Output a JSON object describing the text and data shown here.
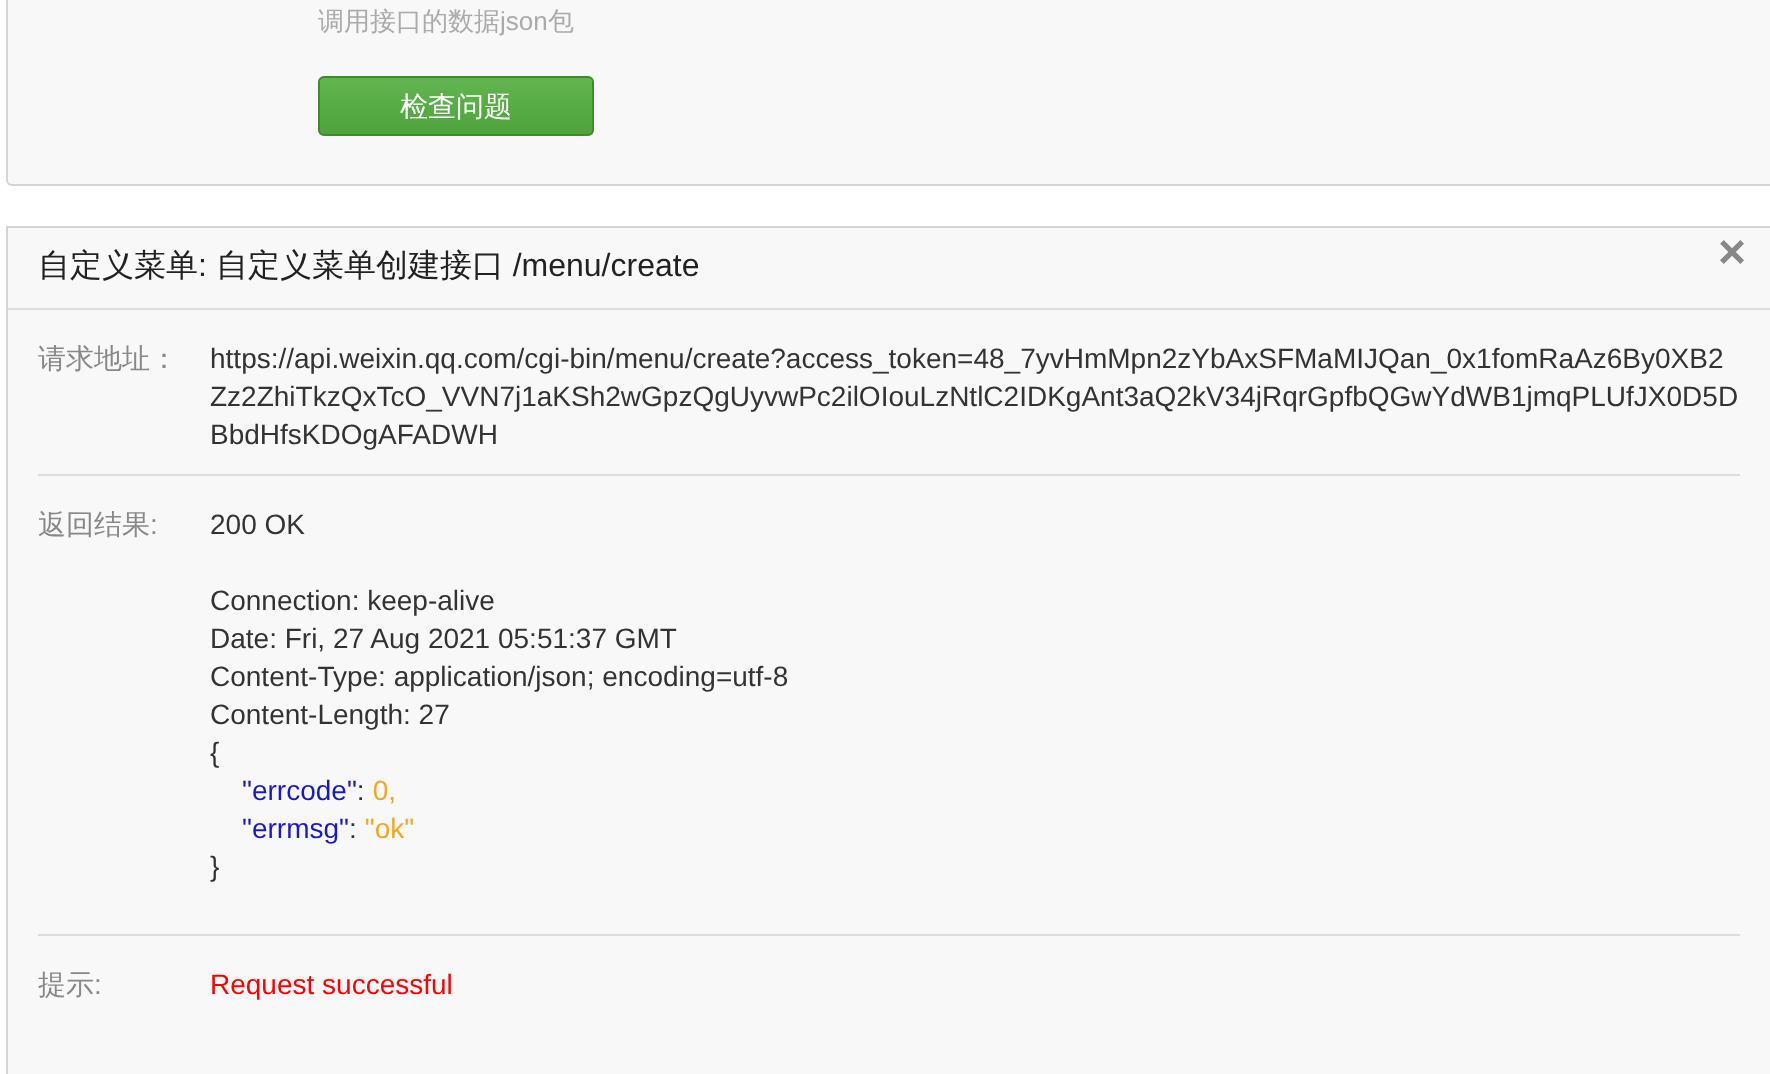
{
  "top_panel": {
    "hint": "调用接口的数据json包",
    "button": "检查问题"
  },
  "result_panel": {
    "title": "自定义菜单: 自定义菜单创建接口 /menu/create",
    "close": "×",
    "request": {
      "label": "请求地址：",
      "url": "https://api.weixin.qq.com/cgi-bin/menu/create?access_token=48_7yvHmMpn2zYbAxSFMaMIJQan_0x1fomRaAz6By0XB2Zz2ZhiTkzQxTcO_VVN7j1aKSh2wGpzQgUyvwPc2ilOIouLzNtlC2IDKgAnt3aQ2kV34jRqrGpfbQGwYdWB1jmqPLUfJX0D5DBbdHfsKDOgAFADWH"
    },
    "response": {
      "label": "返回结果:",
      "status": "200 OK",
      "headers": [
        "Connection: keep-alive",
        "Date: Fri, 27 Aug 2021 05:51:37 GMT",
        "Content-Type: application/json; encoding=utf-8",
        "Content-Length: 27"
      ],
      "body_open": "{",
      "body_entries": [
        {
          "key": "\"errcode\"",
          "colon": ":",
          "value": "0,"
        },
        {
          "key": "\"errmsg\"",
          "colon": ":",
          "value": "\"ok\""
        }
      ],
      "body_close": "}"
    },
    "tip": {
      "label": "提示:",
      "message": "Request successful"
    }
  }
}
